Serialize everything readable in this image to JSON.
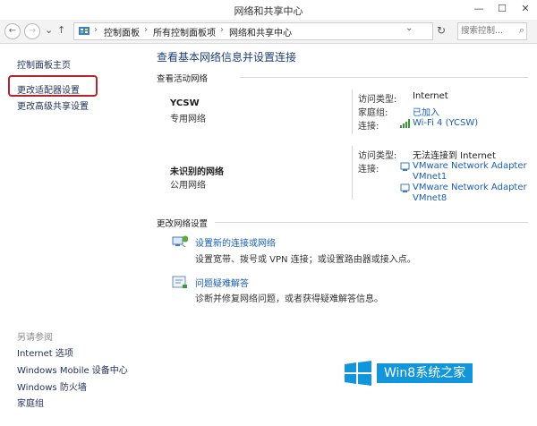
{
  "window": {
    "title": "网络和共享中心",
    "controls": [
      "—",
      "☐",
      "✕"
    ]
  },
  "address": {
    "back": "←",
    "forward": "→",
    "up": "↑",
    "breadcrumbs": [
      "控制面板",
      "所有控制面板项",
      "网络和共享中心"
    ],
    "dropdown": "⌄",
    "refresh": "↻",
    "search_placeholder": "搜索控制...",
    "search_icon": "⌕"
  },
  "sidebar": {
    "home": "控制面板主页",
    "adapter": "更改适配器设置",
    "sharing": "更改高级共享设置",
    "see_also_header": "另请参阅",
    "see_also": [
      "Internet 选项",
      "Windows Mobile 设备中心",
      "Windows 防火墙",
      "家庭组"
    ]
  },
  "main": {
    "title": "查看基本网络信息并设置连接",
    "active_header": "查看活动网络",
    "networks": [
      {
        "name": "YCSW",
        "type": "专用网络",
        "access_label": "访问类型:",
        "access_value": "Internet",
        "homegroup_label": "家庭组:",
        "homegroup_value": "已加入",
        "conn_label": "连接:",
        "conn_value": "Wi-Fi 4 (YCSW)"
      },
      {
        "name": "未识别的网络",
        "type": "公用网络",
        "access_label": "访问类型:",
        "access_value": "无法连接到 Internet",
        "conn_label": "连接:",
        "adapters": [
          "VMware Network Adapter VMnet1",
          "VMware Network Adapter VMnet8"
        ]
      }
    ],
    "change_header": "更改网络设置",
    "tasks": [
      {
        "link": "设置新的连接或网络",
        "desc": "设置宽带、拨号或 VPN 连接；或设置路由器或接入点。",
        "icon": "network-setup-icon"
      },
      {
        "link": "问题疑难解答",
        "desc": "诊断并修复网络问题，或者获得疑难解答信息。",
        "icon": "troubleshoot-icon"
      }
    ]
  },
  "watermark": {
    "text": "Win8系统之家"
  },
  "colors": {
    "link": "#1a5db5",
    "highlight": "#b3242b",
    "watermark_bg": "#1296db"
  }
}
